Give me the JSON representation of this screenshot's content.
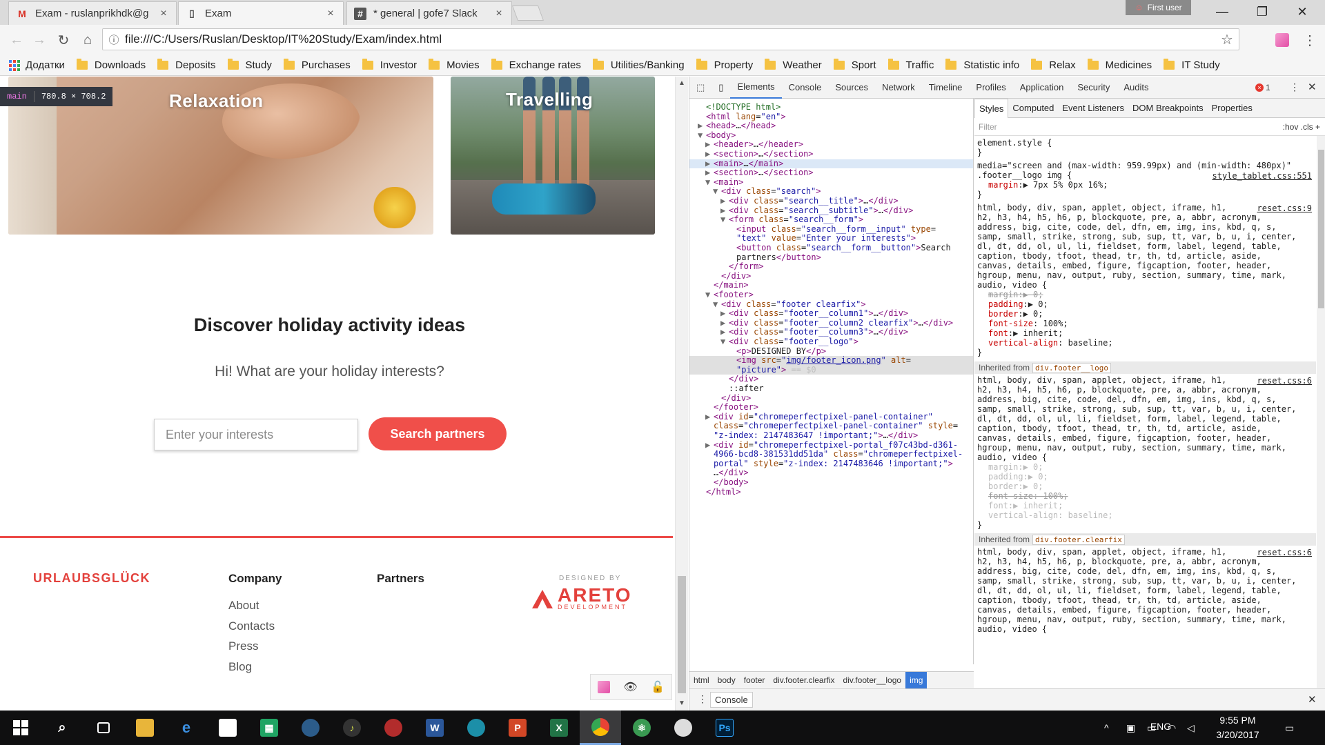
{
  "browser": {
    "tabs": [
      {
        "title": "Exam - ruslanprikhdk@g",
        "icon": "gmail-icon",
        "close": "×"
      },
      {
        "title": "Exam",
        "icon": "page-icon",
        "close": "×"
      },
      {
        "title": "* general | gofe7 Slack",
        "icon": "slack-icon",
        "close": "×"
      }
    ],
    "user_badge": "First user",
    "window_controls": {
      "minimize": "—",
      "maximize": "❐",
      "close": "✕"
    },
    "url": "file:///C:/Users/Ruslan/Desktop/IT%20Study/Exam/index.html",
    "nav": {
      "back": "←",
      "forward": "→",
      "reload": "↻",
      "home": "⌂",
      "star": "☆",
      "menu": "⋮"
    },
    "bookmarks": [
      "Додатки",
      "Downloads",
      "Deposits",
      "Study",
      "Purchases",
      "Investor",
      "Movies",
      "Exchange rates",
      "Utilities/Banking",
      "Property",
      "Weather",
      "Sport",
      "Traffic",
      "Statistic info",
      "Relax",
      "Medicines",
      "IT Study"
    ]
  },
  "page": {
    "inspect_tip": {
      "tag": "main",
      "size": "780.8 × 708.2"
    },
    "cards": [
      {
        "title": "Relaxation"
      },
      {
        "title": "Travelling"
      }
    ],
    "search": {
      "title": "Discover holiday activity ideas",
      "subtitle": "Hi! What are your holiday interests?",
      "placeholder": "Enter your interests",
      "button": "Search partners"
    },
    "footer": {
      "brand": "URLAUBSGLÜCK",
      "company_heading": "Company",
      "company_links": [
        "About",
        "Contacts",
        "Press",
        "Blog"
      ],
      "partners_heading": "Partners",
      "designed_by": "DESIGNED BY",
      "areto_name": "ARETO",
      "areto_sub": "DEVELOPMENT"
    },
    "perf_panel": {
      "eye": "👁",
      "lock": "🔓"
    }
  },
  "devtools": {
    "tabs": [
      "Elements",
      "Console",
      "Sources",
      "Network",
      "Timeline",
      "Profiles",
      "Application",
      "Security",
      "Audits"
    ],
    "active_tab": "Elements",
    "error_count": "1",
    "dom_lines": [
      {
        "indent": 0,
        "tri": "",
        "html": "<span class=\"cm\">&lt;!DOCTYPE html&gt;</span>"
      },
      {
        "indent": 0,
        "tri": "",
        "html": "<span class=\"tg\">&lt;html</span> <span class=\"at\">lang</span>=<span class=\"av\">\"en\"</span><span class=\"tg\">&gt;</span>"
      },
      {
        "indent": 0,
        "tri": "▶",
        "html": "<span class=\"tg\">&lt;head&gt;</span>…<span class=\"tg\">&lt;/head&gt;</span>"
      },
      {
        "indent": 0,
        "tri": "▼",
        "html": "<span class=\"tg\">&lt;body&gt;</span>"
      },
      {
        "indent": 1,
        "tri": "▶",
        "html": "<span class=\"tg\">&lt;header&gt;</span>…<span class=\"tg\">&lt;/header&gt;</span>"
      },
      {
        "indent": 1,
        "tri": "▶",
        "html": "<span class=\"tg\">&lt;section&gt;</span>…<span class=\"tg\">&lt;/section&gt;</span>"
      },
      {
        "indent": 1,
        "tri": "▶",
        "html": "<span class=\"tg\">&lt;main&gt;</span>…<span class=\"tg\">&lt;/main&gt;</span>",
        "sel": "sel-main"
      },
      {
        "indent": 1,
        "tri": "▶",
        "html": "<span class=\"tg\">&lt;section&gt;</span>…<span class=\"tg\">&lt;/section&gt;</span>"
      },
      {
        "indent": 1,
        "tri": "▼",
        "html": "<span class=\"tg\">&lt;main&gt;</span>"
      },
      {
        "indent": 2,
        "tri": "▼",
        "html": "<span class=\"tg\">&lt;div</span> <span class=\"at\">class</span>=<span class=\"av\">\"search\"</span><span class=\"tg\">&gt;</span>"
      },
      {
        "indent": 3,
        "tri": "▶",
        "html": "<span class=\"tg\">&lt;div</span> <span class=\"at\">class</span>=<span class=\"av\">\"search__title\"</span><span class=\"tg\">&gt;</span>…<span class=\"tg\">&lt;/div&gt;</span>"
      },
      {
        "indent": 3,
        "tri": "▶",
        "html": "<span class=\"tg\">&lt;div</span> <span class=\"at\">class</span>=<span class=\"av\">\"search__subtitle\"</span><span class=\"tg\">&gt;</span>…<span class=\"tg\">&lt;/div&gt;</span>"
      },
      {
        "indent": 3,
        "tri": "▼",
        "html": "<span class=\"tg\">&lt;form</span> <span class=\"at\">class</span>=<span class=\"av\">\"search__form\"</span><span class=\"tg\">&gt;</span>"
      },
      {
        "indent": 4,
        "tri": "",
        "html": "<span class=\"tg\">&lt;input</span> <span class=\"at\">class</span>=<span class=\"av\">\"search__form__input\"</span> <span class=\"at\">type</span>="
      },
      {
        "indent": 4,
        "tri": "",
        "html": "<span class=\"av\">\"text\"</span> <span class=\"at\">value</span>=<span class=\"av\">\"Enter your interests\"</span><span class=\"tg\">&gt;</span>"
      },
      {
        "indent": 4,
        "tri": "",
        "html": "<span class=\"tg\">&lt;button</span> <span class=\"at\">class</span>=<span class=\"av\">\"search__form__button\"</span><span class=\"tg\">&gt;</span>Search"
      },
      {
        "indent": 4,
        "tri": "",
        "html": "partners<span class=\"tg\">&lt;/button&gt;</span>"
      },
      {
        "indent": 3,
        "tri": "",
        "html": "<span class=\"tg\">&lt;/form&gt;</span>"
      },
      {
        "indent": 2,
        "tri": "",
        "html": "<span class=\"tg\">&lt;/div&gt;</span>"
      },
      {
        "indent": 1,
        "tri": "",
        "html": "<span class=\"tg\">&lt;/main&gt;</span>"
      },
      {
        "indent": 1,
        "tri": "▼",
        "html": "<span class=\"tg\">&lt;footer&gt;</span>"
      },
      {
        "indent": 2,
        "tri": "▼",
        "html": "<span class=\"tg\">&lt;div</span> <span class=\"at\">class</span>=<span class=\"av\">\"footer clearfix\"</span><span class=\"tg\">&gt;</span>"
      },
      {
        "indent": 3,
        "tri": "▶",
        "html": "<span class=\"tg\">&lt;div</span> <span class=\"at\">class</span>=<span class=\"av\">\"footer__column1\"</span><span class=\"tg\">&gt;</span>…<span class=\"tg\">&lt;/div&gt;</span>"
      },
      {
        "indent": 3,
        "tri": "▶",
        "html": "<span class=\"tg\">&lt;div</span> <span class=\"at\">class</span>=<span class=\"av\">\"footer__column2 clearfix\"</span><span class=\"tg\">&gt;</span>…<span class=\"tg\">&lt;/div&gt;</span>"
      },
      {
        "indent": 3,
        "tri": "▶",
        "html": "<span class=\"tg\">&lt;div</span> <span class=\"at\">class</span>=<span class=\"av\">\"footer__column3\"</span><span class=\"tg\">&gt;</span>…<span class=\"tg\">&lt;/div&gt;</span>"
      },
      {
        "indent": 3,
        "tri": "▼",
        "html": "<span class=\"tg\">&lt;div</span> <span class=\"at\">class</span>=<span class=\"av\">\"footer__logo\"</span><span class=\"tg\">&gt;</span>"
      },
      {
        "indent": 4,
        "tri": "",
        "html": "<span class=\"tg\">&lt;p&gt;</span>DESIGNED BY<span class=\"tg\">&lt;/p&gt;</span>"
      },
      {
        "indent": 4,
        "tri": "",
        "html": "<span class=\"tg\">&lt;img</span> <span class=\"at\">src</span>=<span class=\"av\">\"<u>img/footer_icon.png</u>\"</span> <span class=\"at\">alt</span>=",
        "sel": "sel-img"
      },
      {
        "indent": 4,
        "tri": "",
        "html": "<span class=\"av\">\"picture\"</span><span class=\"tg\">&gt;</span> <span class=\"dt\">== $0</span>",
        "sel": "sel-img"
      },
      {
        "indent": 3,
        "tri": "",
        "html": "<span class=\"tg\">&lt;/div&gt;</span>"
      },
      {
        "indent": 3,
        "tri": "",
        "html": "::after"
      },
      {
        "indent": 2,
        "tri": "",
        "html": "<span class=\"tg\">&lt;/div&gt;</span>"
      },
      {
        "indent": 1,
        "tri": "",
        "html": "<span class=\"tg\">&lt;/footer&gt;</span>"
      },
      {
        "indent": 1,
        "tri": "▶",
        "html": "<span class=\"tg\">&lt;div</span> <span class=\"at\">id</span>=<span class=\"av\">\"chromeperfectpixel-panel-container\"</span>"
      },
      {
        "indent": 1,
        "tri": "",
        "html": "<span class=\"at\">class</span>=<span class=\"av\">\"chromeperfectpixel-panel-container\"</span> <span class=\"at\">style</span>="
      },
      {
        "indent": 1,
        "tri": "",
        "html": "<span class=\"av\">\"z-index: 2147483647 !important;\"</span><span class=\"tg\">&gt;</span>…<span class=\"tg\">&lt;/div&gt;</span>"
      },
      {
        "indent": 1,
        "tri": "▶",
        "html": "<span class=\"tg\">&lt;div</span> <span class=\"at\">id</span>=<span class=\"av\">\"chromeperfectpixel-portal_f07c43bd-d361-</span>"
      },
      {
        "indent": 1,
        "tri": "",
        "html": "<span class=\"av\">4966-bcd8-381531dd51da\"</span> <span class=\"at\">class</span>=<span class=\"av\">\"chromeperfectpixel-</span>"
      },
      {
        "indent": 1,
        "tri": "",
        "html": "<span class=\"av\">portal\"</span> <span class=\"at\">style</span>=<span class=\"av\">\"z-index: 2147483646 !important;\"</span><span class=\"tg\">&gt;</span>"
      },
      {
        "indent": 1,
        "tri": "",
        "html": "…<span class=\"tg\">&lt;/div&gt;</span>"
      },
      {
        "indent": 1,
        "tri": "",
        "html": "<span class=\"tg\">&lt;/body&gt;</span>"
      },
      {
        "indent": 0,
        "tri": "",
        "html": "<span class=\"tg\">&lt;/html&gt;</span>"
      }
    ],
    "breadcrumbs": [
      "html",
      "body",
      "footer",
      "div.footer.clearfix",
      "div.footer__logo",
      "img"
    ],
    "styles_tabs": [
      "Styles",
      "Computed",
      "Event Listeners",
      "DOM Breakpoints",
      "Properties"
    ],
    "filter_placeholder": "Filter",
    "filter_opts": ":hov  .cls  +",
    "inherited_from_1": "div.footer__logo",
    "inherited_from_2": "div.footer.clearfix",
    "inherited_label": "Inherited from",
    "console_label": "Console"
  },
  "taskbar": {
    "time": "9:55 PM",
    "date": "3/20/2017",
    "lang": "ENG"
  }
}
